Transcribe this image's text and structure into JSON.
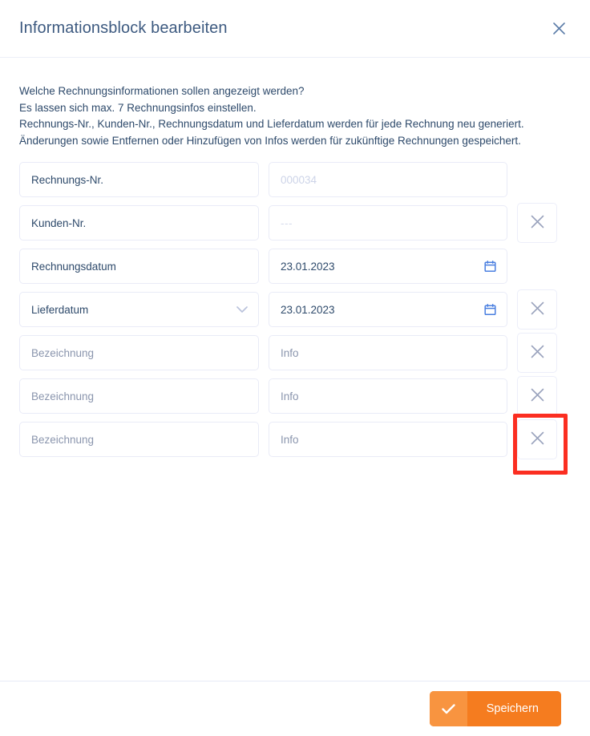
{
  "dialog": {
    "title": "Informationsblock bearbeiten",
    "close_icon": "close-icon",
    "intro_lines": [
      "Welche Rechnungsinformationen sollen angezeigt werden?",
      "Es lassen sich max. 7 Rechnungsinfos einstellen.",
      "Rechnungs-Nr., Kunden-Nr., Rechnungsdatum und Lieferdatum werden für jede Rechnung neu generiert.",
      "Änderungen sowie Entfernen oder Hinzufügen von Infos werden für zukünftige Rechnungen gespeichert."
    ]
  },
  "rows": [
    {
      "label": "Rechnungs-Nr.",
      "label_is_placeholder": false,
      "has_caret": false,
      "value": "000034",
      "value_style": "faint",
      "value_type": "text",
      "has_calendar": false,
      "removable": false,
      "highlighted": false
    },
    {
      "label": "Kunden-Nr.",
      "label_is_placeholder": false,
      "has_caret": false,
      "value": "---",
      "value_style": "dash",
      "value_type": "text",
      "has_calendar": false,
      "removable": true,
      "highlighted": false
    },
    {
      "label": "Rechnungsdatum",
      "label_is_placeholder": false,
      "has_caret": false,
      "value": "23.01.2023",
      "value_style": "dark",
      "value_type": "date",
      "has_calendar": true,
      "removable": false,
      "highlighted": false
    },
    {
      "label": "Lieferdatum",
      "label_is_placeholder": false,
      "has_caret": true,
      "value": "23.01.2023",
      "value_style": "dark",
      "value_type": "date",
      "has_calendar": true,
      "removable": true,
      "highlighted": false
    },
    {
      "label": "Bezeichnung",
      "label_is_placeholder": true,
      "has_caret": false,
      "value": "Info",
      "value_style": "muted",
      "value_type": "text",
      "has_calendar": false,
      "removable": true,
      "highlighted": false
    },
    {
      "label": "Bezeichnung",
      "label_is_placeholder": true,
      "has_caret": false,
      "value": "Info",
      "value_style": "muted",
      "value_type": "text",
      "has_calendar": false,
      "removable": true,
      "highlighted": false
    },
    {
      "label": "Bezeichnung",
      "label_is_placeholder": true,
      "has_caret": false,
      "value": "Info",
      "value_style": "muted",
      "value_type": "text",
      "has_calendar": false,
      "removable": true,
      "highlighted": true
    }
  ],
  "footer": {
    "save_label": "Speichern",
    "save_icon": "check-icon"
  },
  "colors": {
    "title": "#3d5a80",
    "text": "#2e4a6b",
    "placeholder": "#8a95ad",
    "faint": "#cdd4e8",
    "border": "#e9ebf7",
    "accent_orange": "#f57c1f",
    "accent_orange_light": "#f89440",
    "calendar_blue": "#4a7fe0",
    "close_blue": "#5b7ca8",
    "highlight_red": "#fb2e21"
  }
}
